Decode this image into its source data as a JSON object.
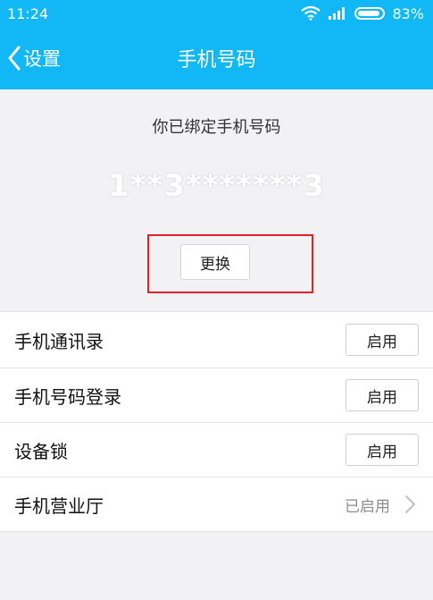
{
  "status_bar": {
    "time": "11:24",
    "battery": "83%",
    "battery_level": 0.83
  },
  "nav": {
    "back_label": "设置",
    "title": "手机号码"
  },
  "bound": {
    "label": "你已绑定手机号码",
    "masked_number": "1**3*******3",
    "change_button": "更换"
  },
  "list": [
    {
      "label": "手机通讯录",
      "button": "启用"
    },
    {
      "label": "手机号码登录",
      "button": "启用"
    },
    {
      "label": "设备锁",
      "button": "启用"
    },
    {
      "label": "手机营业厅",
      "status": "已启用"
    }
  ],
  "colors": {
    "accent": "#12b7f5",
    "highlight": "#e0202a",
    "background": "#f2f2f4"
  }
}
